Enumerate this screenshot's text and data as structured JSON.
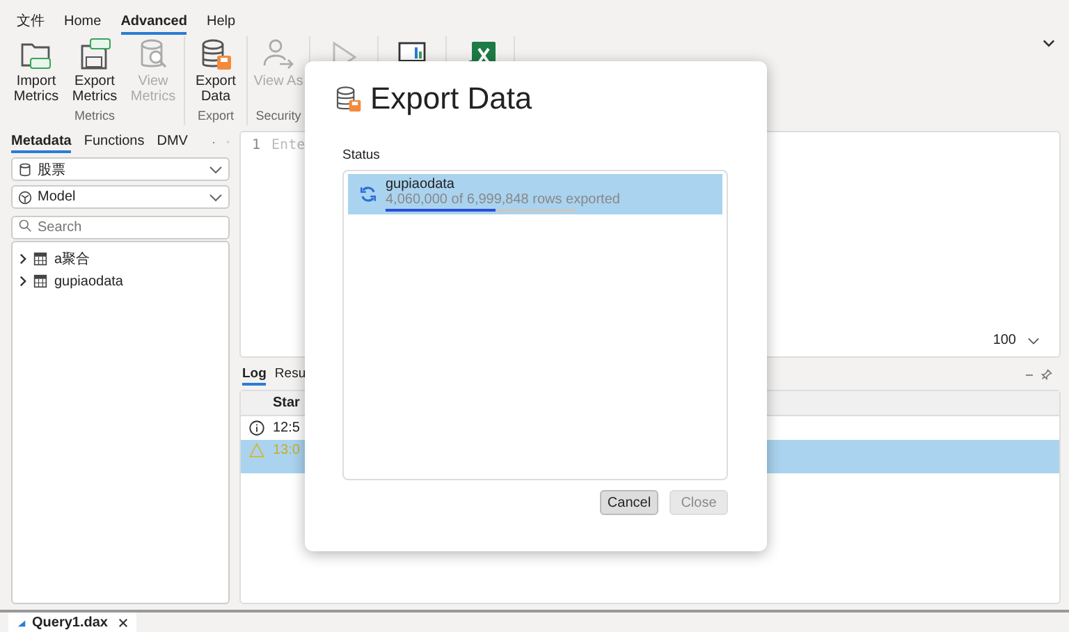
{
  "menu": [
    {
      "label": "文件",
      "selected": false
    },
    {
      "label": "Home",
      "selected": false
    },
    {
      "label": "Advanced",
      "selected": true
    },
    {
      "label": "Help",
      "selected": false
    }
  ],
  "ribbon": {
    "groups": [
      {
        "label": "Metrics",
        "buttons": [
          {
            "label": "Import Metrics",
            "kind": "import",
            "disabled": false
          },
          {
            "label": "Export Metrics",
            "kind": "export-metrics",
            "disabled": false
          },
          {
            "label": "View Metrics",
            "kind": "view-metrics",
            "disabled": true
          }
        ]
      },
      {
        "label": "Export",
        "buttons": [
          {
            "label": "Export Data",
            "kind": "export-data",
            "disabled": false
          }
        ]
      },
      {
        "label": "Security",
        "buttons": [
          {
            "label": "View As",
            "kind": "view-as",
            "disabled": true
          }
        ]
      }
    ],
    "hidden_buttons": [
      {
        "kind": "play"
      },
      {
        "kind": "report"
      },
      {
        "kind": "excel"
      }
    ]
  },
  "metadata_panel": {
    "tabs": [
      {
        "label": "Metadata",
        "selected": true
      },
      {
        "label": "Functions",
        "selected": false
      },
      {
        "label": "DMV",
        "selected": false
      }
    ],
    "database": "股票",
    "model": "Model",
    "search": {
      "placeholder": "Search"
    },
    "tree": [
      {
        "label": "a聚合",
        "expanded": false
      },
      {
        "label": "gupiaodata",
        "expanded": false
      }
    ]
  },
  "editor": {
    "line_number": "1",
    "placeholder": "Ente",
    "zoom": "100"
  },
  "log_panel": {
    "tabs": [
      {
        "label": "Log",
        "selected": true
      },
      {
        "label": "Resu",
        "selected": false
      }
    ],
    "columns": [
      "Star"
    ],
    "rows": [
      {
        "kind": "info",
        "time": "12:5",
        "selected": false
      },
      {
        "kind": "warning",
        "time": "13:0",
        "selected": true
      }
    ]
  },
  "document_tabs": [
    {
      "label": "Query1.dax",
      "selected": true
    }
  ],
  "dialog": {
    "title": "Export Data",
    "status_label": "Status",
    "items": [
      {
        "name": "gupiaodata",
        "progress_text": "4,060,000 of 6,999,848 rows exported",
        "level": 0.58,
        "selected": true
      }
    ],
    "buttons": [
      {
        "label": "Cancel",
        "disabled": false
      },
      {
        "label": "Close",
        "disabled": true
      }
    ]
  }
}
